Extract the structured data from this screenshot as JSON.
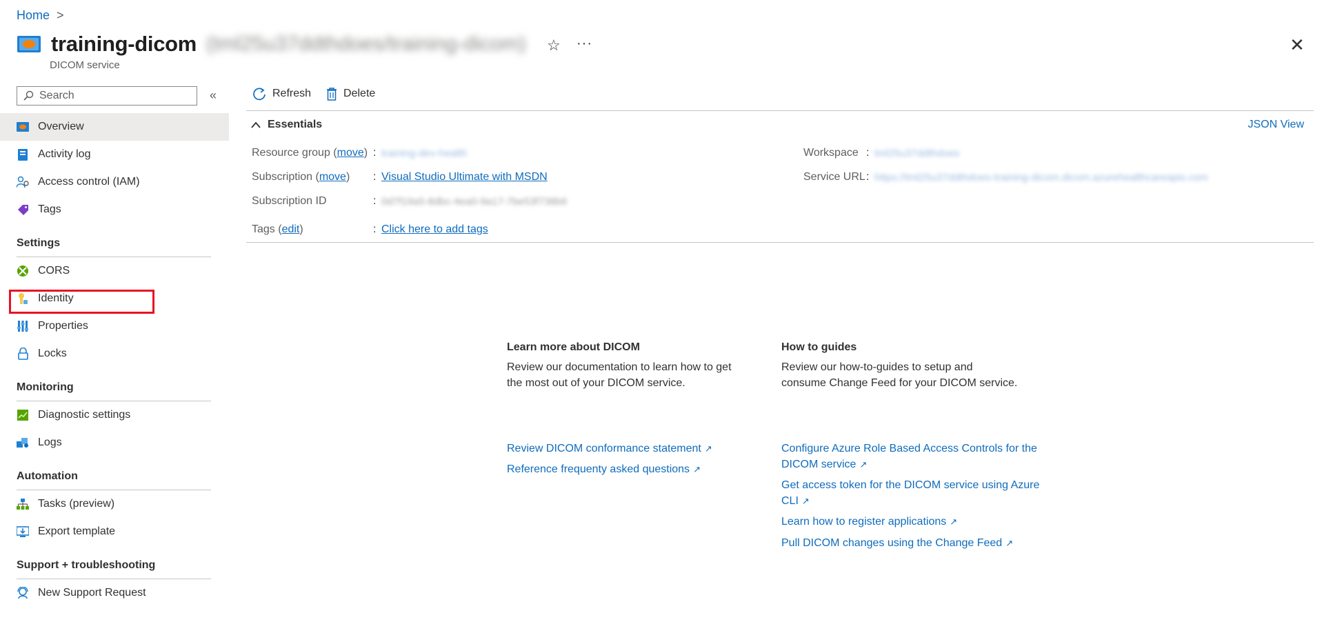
{
  "breadcrumb": {
    "home": "Home",
    "separator": ">"
  },
  "header": {
    "title": "training-dicom",
    "title_blurred": "(tml25u37ddthdoes/training-dicom)",
    "subtitle": "DICOM service",
    "star_icon": "☆",
    "more_icon": "···",
    "close_icon": "✕"
  },
  "sidebar": {
    "search_placeholder": "Search",
    "collapse_icon": "«",
    "top_items": [
      {
        "label": "Overview",
        "icon": "dicom-icon"
      },
      {
        "label": "Activity log",
        "icon": "activity-log-icon"
      },
      {
        "label": "Access control (IAM)",
        "icon": "iam-icon"
      },
      {
        "label": "Tags",
        "icon": "tag-icon"
      }
    ],
    "sections": [
      {
        "title": "Settings",
        "items": [
          {
            "label": "CORS",
            "icon": "cors-icon"
          },
          {
            "label": "Identity",
            "icon": "identity-icon"
          },
          {
            "label": "Properties",
            "icon": "properties-icon"
          },
          {
            "label": "Locks",
            "icon": "lock-icon"
          }
        ]
      },
      {
        "title": "Monitoring",
        "items": [
          {
            "label": "Diagnostic settings",
            "icon": "diagnostic-icon"
          },
          {
            "label": "Logs",
            "icon": "logs-icon"
          }
        ]
      },
      {
        "title": "Automation",
        "items": [
          {
            "label": "Tasks (preview)",
            "icon": "tasks-icon"
          },
          {
            "label": "Export template",
            "icon": "export-icon"
          }
        ]
      },
      {
        "title": "Support + troubleshooting",
        "items": [
          {
            "label": "New Support Request",
            "icon": "support-icon"
          }
        ]
      }
    ]
  },
  "toolbar": {
    "refresh": "Refresh",
    "delete": "Delete"
  },
  "essentials": {
    "title": "Essentials",
    "json_view": "JSON View",
    "resource_group_label": "Resource group",
    "move": "move",
    "resource_group_value": "training-dev-health",
    "subscription_label": "Subscription",
    "subscription_value": "Visual Studio Ultimate with MSDN",
    "subscription_id_label": "Subscription ID",
    "subscription_id_value": "0d7f19a5-8dbc-4ea0-9a17-7be53f738b6",
    "tags_label": "Tags",
    "edit": "edit",
    "tags_value": "Click here to add tags",
    "workspace_label": "Workspace",
    "workspace_value": "tml25u37ddthdoes",
    "service_url_label": "Service URL",
    "service_url_value": "https://tml25u37ddthdoes-training-dicom.dicom.azurehealthcareapis.com",
    "colon": ":"
  },
  "learn": {
    "heading": "Learn more about DICOM",
    "text_1": "Review our documentation to learn how to get",
    "text_2": "the most out of your DICOM service.",
    "link_1": "Review DICOM conformance statement",
    "link_2": "Reference frequenty asked questions"
  },
  "guides": {
    "heading": "How to guides",
    "text_1": "Review our how-to-guides to setup and",
    "text_2": "consume Change Feed for your DICOM service.",
    "link_1a": "Configure Azure Role Based Access Controls for the",
    "link_1b": "DICOM service",
    "link_2a": "Get access token for the DICOM service using Azure",
    "link_2b": "CLI",
    "link_3": "Learn how to register applications",
    "link_4": "Pull DICOM changes using the Change Feed"
  },
  "colors": {
    "accent": "#0f6cbd",
    "highlight": "#e81123",
    "active_bg": "#edebe9"
  }
}
